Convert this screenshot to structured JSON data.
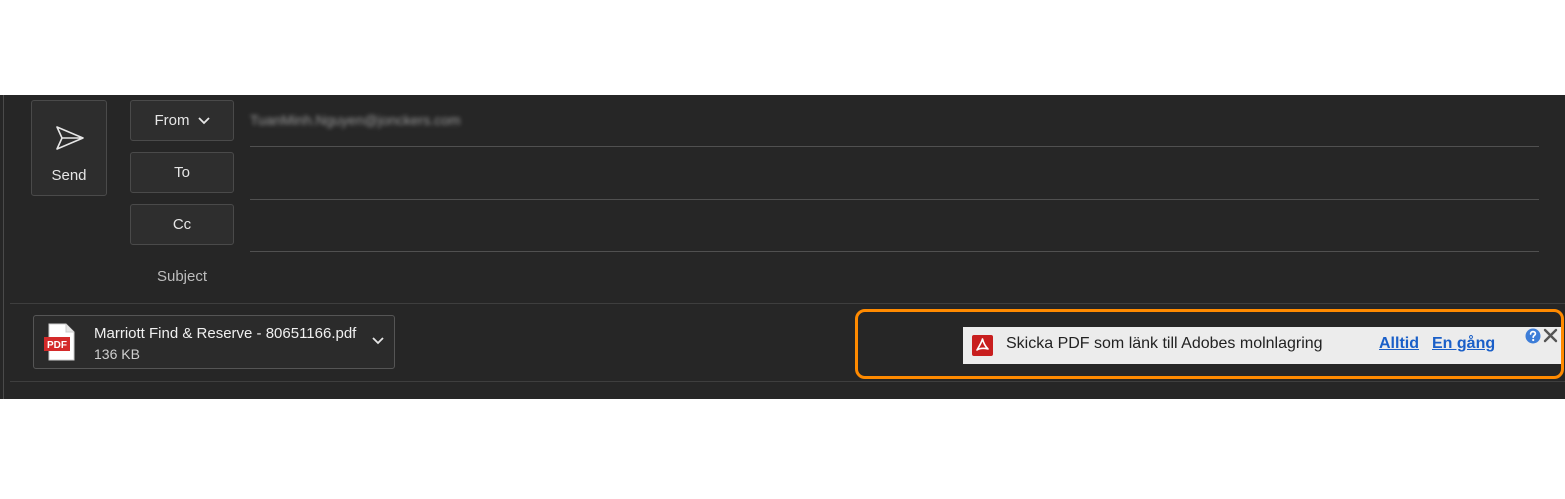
{
  "compose": {
    "send_label": "Send",
    "from_label": "From",
    "to_label": "To",
    "cc_label": "Cc",
    "subject_label": "Subject",
    "from_value": "TuanMinh.Nguyen@jonckers.com"
  },
  "attachment": {
    "filename": "Marriott Find & Reserve - 80651166.pdf",
    "size": "136 KB",
    "icon": "pdf-file-icon",
    "icon_text": "PDF"
  },
  "adobe_bar": {
    "message": "Skicka PDF som länk till Adobes molnlagring",
    "always_label": "Alltid",
    "once_label": "En gång",
    "help_icon": "question-icon",
    "close_icon": "close-icon"
  },
  "colors": {
    "compose_bg": "#262626",
    "highlight_border": "#ff8a00",
    "link": "#1a5fc8",
    "pdf_red": "#d42a2a"
  }
}
